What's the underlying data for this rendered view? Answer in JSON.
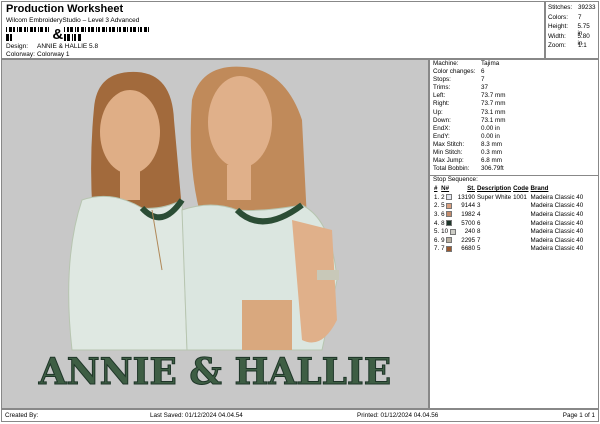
{
  "header": {
    "title": "Production Worksheet",
    "subtitle": "Wilcom EmbroideryStudio – Level 3 Advanced",
    "barcode_char": "&",
    "design_label": "Design:",
    "design_value": "ANNIE & HALLIE 5.8",
    "colorway_label": "Colorway:",
    "colorway_value": "Colorway 1"
  },
  "stats": [
    {
      "label": "Stitches:",
      "value": "39233"
    },
    {
      "label": "Colors:",
      "value": "7"
    },
    {
      "label": "Height:",
      "value": "5.75 in"
    },
    {
      "label": "Width:",
      "value": "5.80 in"
    },
    {
      "label": "Zoom:",
      "value": "1:1"
    }
  ],
  "info": [
    {
      "label": "Machine:",
      "value": "Tajima"
    },
    {
      "label": "Color changes:",
      "value": "6"
    },
    {
      "label": "Stops:",
      "value": "7"
    },
    {
      "label": "Trims:",
      "value": "37"
    },
    {
      "label": "Left:",
      "value": "73.7 mm"
    },
    {
      "label": "Right:",
      "value": "73.7 mm"
    },
    {
      "label": "Up:",
      "value": "73.1 mm"
    },
    {
      "label": "Down:",
      "value": "73.1 mm"
    },
    {
      "label": "EndX:",
      "value": "0.00 in"
    },
    {
      "label": "EndY:",
      "value": "0.00 in"
    },
    {
      "label": "Max Stitch:",
      "value": "8.3 mm"
    },
    {
      "label": "Min Stitch:",
      "value": "0.3 mm"
    },
    {
      "label": "Max Jump:",
      "value": "6.8 mm"
    },
    {
      "label": "Total Bobbin:",
      "value": "306.79ft"
    }
  ],
  "stop_sequence": {
    "title": "Stop Sequence:",
    "headers": [
      "#",
      "N#",
      "St.",
      "Description",
      "Code",
      "Brand"
    ],
    "rows": [
      {
        "n": "1.",
        "num": "2",
        "color": "#e6e8f0",
        "st": "13190",
        "desc": "Super White",
        "code": "1001",
        "brand": "Madeira Classic 40"
      },
      {
        "n": "2.",
        "num": "5",
        "color": "#d9a080",
        "st": "9144",
        "desc": "3",
        "code": "",
        "brand": "Madeira Classic 40"
      },
      {
        "n": "3.",
        "num": "6",
        "color": "#c48c6c",
        "st": "1982",
        "desc": "4",
        "code": "",
        "brand": "Madeira Classic 40"
      },
      {
        "n": "4.",
        "num": "8",
        "color": "#1c3528",
        "st": "5700",
        "desc": "6",
        "code": "",
        "brand": "Madeira Classic 40"
      },
      {
        "n": "5.",
        "num": "10",
        "color": "#cdcdc6",
        "st": "240",
        "desc": "8",
        "code": "",
        "brand": "Madeira Classic 40"
      },
      {
        "n": "6.",
        "num": "9",
        "color": "#b9b1a2",
        "st": "2295",
        "desc": "7",
        "code": "",
        "brand": "Madeira Classic 40"
      },
      {
        "n": "7.",
        "num": "7",
        "color": "#9b5a30",
        "st": "6680",
        "desc": "5",
        "code": "",
        "brand": "Madeira Classic 40"
      }
    ]
  },
  "design": {
    "lettering": "ANNIE & HALLIE"
  },
  "footer": {
    "created": "Created By:",
    "saved": "Last Saved: 01/12/2024 04.04.54",
    "printed": "Printed: 01/12/2024 04.04.56",
    "page": "Page 1 of 1"
  }
}
